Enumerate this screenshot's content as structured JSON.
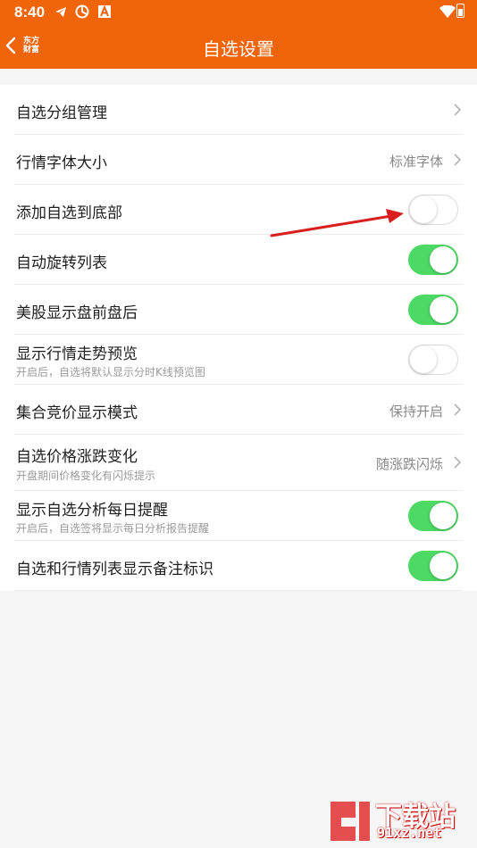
{
  "status_bar": {
    "time": "8:40"
  },
  "header": {
    "back_label": "东方财富",
    "title": "自选设置"
  },
  "settings": [
    {
      "label": "自选分组管理",
      "value": "",
      "control": "chevron"
    },
    {
      "label": "行情字体大小",
      "value": "标准字体",
      "control": "chevron"
    },
    {
      "label": "添加自选到底部",
      "control": "toggle",
      "state": "off"
    },
    {
      "label": "自动旋转列表",
      "control": "toggle",
      "state": "on"
    },
    {
      "label": "美股显示盘前盘后",
      "control": "toggle",
      "state": "on"
    },
    {
      "label": "显示行情走势预览",
      "sublabel": "开启后，自选将默认显示分时K线预览图",
      "control": "toggle",
      "state": "off"
    },
    {
      "label": "集合竞价显示模式",
      "value": "保持开启",
      "control": "chevron"
    },
    {
      "label": "自选价格涨跌变化",
      "sublabel": "开盘期间价格变化有闪烁提示",
      "value": "随涨跌闪烁",
      "control": "chevron"
    },
    {
      "label": "显示自选分析每日提醒",
      "sublabel": "开启后，自选签将显示每日分析报告提醒",
      "control": "toggle",
      "state": "on"
    },
    {
      "label": "自选和行情列表显示备注标识",
      "control": "toggle",
      "state": "on"
    }
  ],
  "watermark": {
    "text": "下载站",
    "url": "91xz.net"
  },
  "colors": {
    "header": "#f0640a",
    "toggle_on": "#4cd964",
    "arrow": "#d81e1e"
  }
}
